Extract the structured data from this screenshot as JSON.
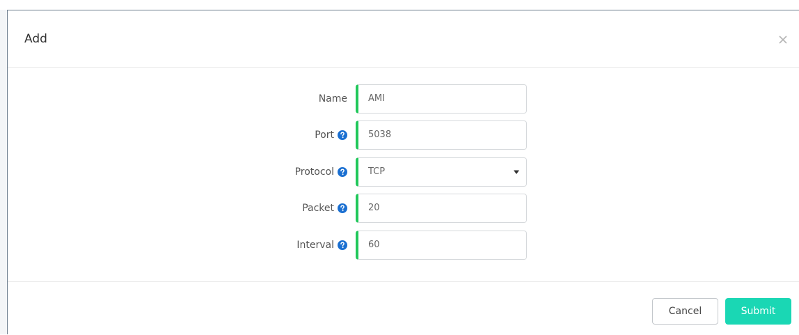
{
  "dialog": {
    "title": "Add"
  },
  "form": {
    "name": {
      "label": "Name",
      "value": "AMI"
    },
    "port": {
      "label": "Port",
      "value": "5038"
    },
    "protocol": {
      "label": "Protocol",
      "value": "TCP"
    },
    "packet": {
      "label": "Packet",
      "value": "20"
    },
    "interval": {
      "label": "Interval",
      "value": "60"
    }
  },
  "footer": {
    "cancel_label": "Cancel",
    "submit_label": "Submit"
  },
  "colors": {
    "accent_valid": "#21c85b",
    "submit_bg": "#1ad7b4",
    "help_icon": "#1a6fd1"
  },
  "icons": {
    "close": "close-icon",
    "help": "question-circle-icon",
    "dropdown": "caret-down-icon"
  }
}
